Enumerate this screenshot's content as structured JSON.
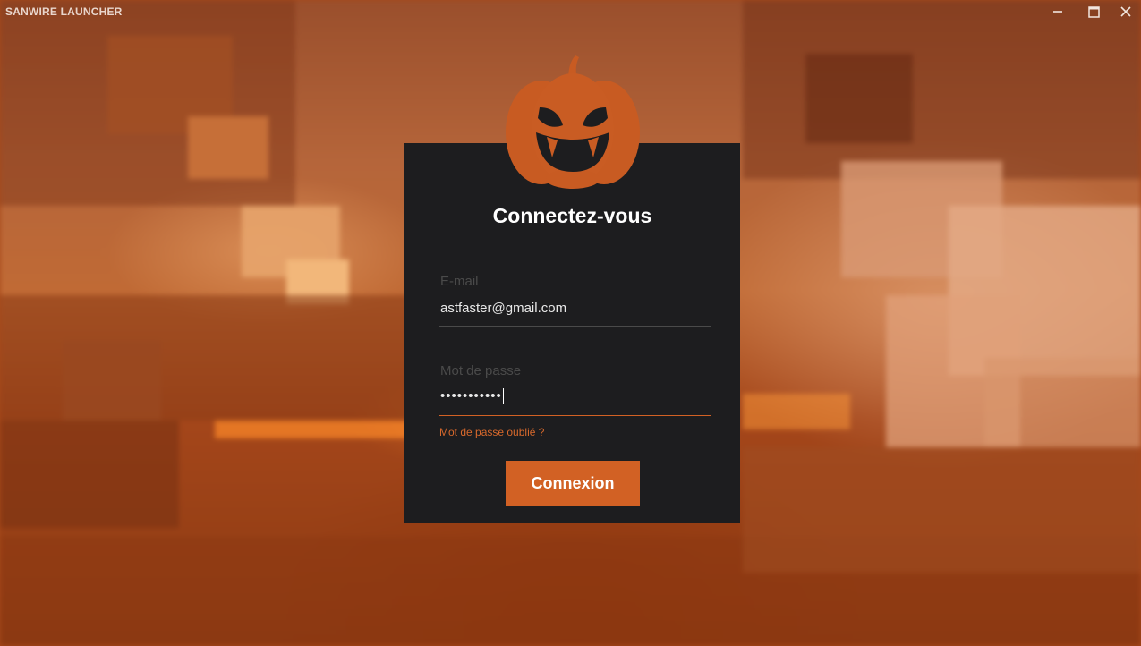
{
  "app": {
    "title": "SANWIRE LAUNCHER"
  },
  "window_controls": {
    "minimize_icon": "minimize-icon",
    "maximize_icon": "maximize-icon",
    "close_icon": "close-icon"
  },
  "login": {
    "title": "Connectez-vous",
    "email_label": "E-mail",
    "email_value": "astfaster@gmail.com",
    "password_label": "Mot de passe",
    "password_masked": "•••••••••••",
    "forgot_password": "Mot de passe oublié ?",
    "submit_label": "Connexion"
  },
  "colors": {
    "accent": "#d26124",
    "panel": "#1d1d1f",
    "pumpkin": "#c85b22"
  }
}
